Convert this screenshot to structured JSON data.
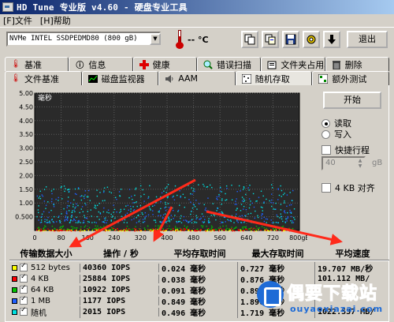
{
  "window": {
    "title": "HD Tune 专业版 v4.60 - 硬盘专业工具"
  },
  "menu": [
    "[F]文件",
    "[H]帮助"
  ],
  "toolbar": {
    "drive": "NVMe   INTEL SSDPEDMD80 (800 gB)",
    "temperature": "-- °C",
    "exit_label": "退出"
  },
  "tabs_row1": [
    {
      "label": "基准",
      "icon": "thermometer-icon"
    },
    {
      "label": "信息",
      "icon": "info-icon"
    },
    {
      "label": "健康",
      "icon": "health-cross-icon"
    },
    {
      "label": "错误扫描",
      "icon": "magnifier-icon"
    },
    {
      "label": "文件夹占用率",
      "icon": "folder-icon"
    },
    {
      "label": "删除",
      "icon": "trash-icon"
    }
  ],
  "tabs_row2": [
    {
      "label": "文件基准",
      "icon": "thermometer-icon"
    },
    {
      "label": "磁盘监视器",
      "icon": "monitor-chart-icon"
    },
    {
      "label": "AAM",
      "icon": "speaker-icon"
    },
    {
      "label": "随机存取",
      "icon": "random-access-icon",
      "active": true
    },
    {
      "label": "额外测试",
      "icon": "extra-tests-icon"
    }
  ],
  "controls": {
    "start_label": "开始",
    "read_label": "读取",
    "write_label": "写入",
    "mode": "read",
    "quick_path_label": "快捷行程",
    "quick_path_value": "40",
    "gb_label": "gB",
    "align_label": "4 KB 对齐"
  },
  "chart_data": {
    "type": "scatter",
    "ylabel": "毫秒",
    "xlabel": "",
    "x_ticks": [
      "0",
      "80",
      "160",
      "240",
      "320",
      "400",
      "480",
      "560",
      "640",
      "720",
      "800gB"
    ],
    "y_ticks": [
      "0.500",
      "1.00",
      "1.50",
      "2.00",
      "2.50",
      "3.00",
      "3.50",
      "4.00",
      "4.50",
      "5.00"
    ],
    "xlim": [
      0,
      800
    ],
    "ylim": [
      0,
      5
    ],
    "background": "#2a2a2a",
    "series": [
      {
        "name": "512 bytes",
        "color": "#ffff00",
        "band": [
          0.0,
          0.05
        ]
      },
      {
        "name": "4 KB",
        "color": "#ff0000",
        "band": [
          0.0,
          0.1
        ]
      },
      {
        "name": "64 KB",
        "color": "#00c000",
        "band": [
          0.05,
          0.2
        ]
      },
      {
        "name": "1 MB",
        "color": "#2060ff",
        "band": [
          0.3,
          1.6
        ]
      },
      {
        "name": "随机",
        "color": "#00e0e0",
        "band": [
          0.3,
          1.7
        ]
      }
    ]
  },
  "results": {
    "headers": [
      "传输数据大小",
      "操作 / 秒",
      "平均存取时间",
      "最大存取时间",
      "平均速度"
    ],
    "rows": [
      {
        "color": "#ffff00",
        "size": "512 bytes",
        "ops": "40360 IOPS",
        "avg": "0.024 毫秒",
        "max": "0.727 毫秒",
        "speed": "19.707 MB/秒"
      },
      {
        "color": "#ff0000",
        "size": "4 KB",
        "ops": "25884 IOPS",
        "avg": "0.038 毫秒",
        "max": "0.876 毫秒",
        "speed": "101.112 MB/"
      },
      {
        "color": "#00c000",
        "size": "64 KB",
        "ops": "10922 IOPS",
        "avg": "0.091 毫秒",
        "max": "0.899 毫秒",
        "speed": ""
      },
      {
        "color": "#2060ff",
        "size": "1 MB",
        "ops": "1177 IOPS",
        "avg": "0.849 毫秒",
        "max": "1.896 毫秒",
        "speed": ""
      },
      {
        "color": "#00e0e0",
        "size": "随机",
        "ops": "2015 IOPS",
        "avg": "0.496 毫秒",
        "max": "1.719 毫秒",
        "speed": "1022.537 MB/"
      }
    ]
  },
  "watermark": {
    "text": "偶要下载站",
    "url": "ouyaoxiazai.com"
  },
  "colors": {
    "arrow": "#ff2a1a",
    "titlebar": "#0a246a"
  }
}
